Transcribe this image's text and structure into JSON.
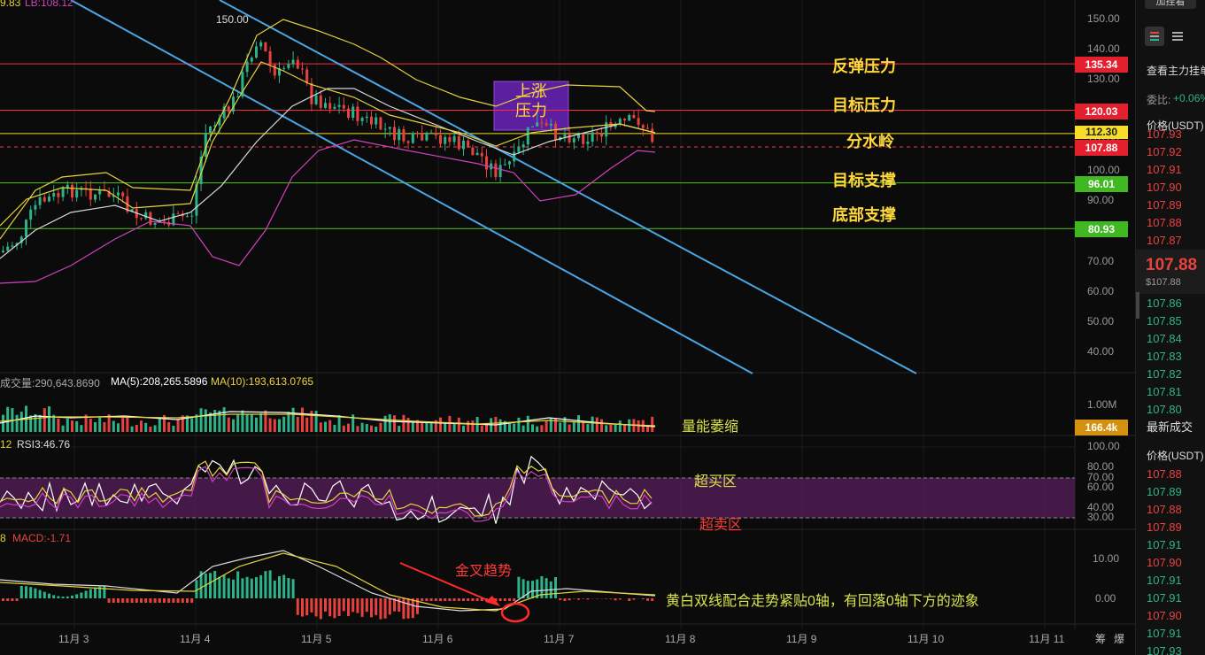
{
  "header": {
    "partial_left": "9.83",
    "partial_lb": "LB:108.12"
  },
  "price_axis": [
    "150.00",
    "140.00",
    "130.00",
    "120.00",
    "110.00",
    "100.00",
    "90.00",
    "80.00",
    "70.00",
    "60.00",
    "50.00",
    "40.00"
  ],
  "peak_label": "150.00",
  "levels": [
    {
      "name": "反弹压力",
      "price": "135.34",
      "color": "#ff2a3a"
    },
    {
      "name": "目标压力",
      "price": "120.03",
      "color": "#ff2a3a"
    },
    {
      "name": "分水岭",
      "price": "112.30",
      "color": "#f7dd2a"
    },
    {
      "name": "目标支撑",
      "price": "96.01",
      "color": "#52c41a"
    },
    {
      "name": "底部支撑",
      "price": "80.93",
      "color": "#52c41a"
    }
  ],
  "last_price_tag": "107.88",
  "box_label": "上涨\n压力",
  "volume": {
    "label": "成交量:290,643.8690",
    "ma5": "MA(5):208,265.5896",
    "ma10": "MA(10):193,613.0765",
    "axis": "1.00M",
    "tag": "166.4k",
    "annotation": "量能萎缩"
  },
  "rsi": {
    "label_prefix": "12",
    "label": "RSI3:46.76",
    "axis": [
      "100.00",
      "80.00",
      "70.00",
      "60.00",
      "40.00",
      "30.00"
    ],
    "overbought": "超买区",
    "oversold": "超卖区"
  },
  "macd": {
    "label_prefix": "8",
    "label": "MACD:-1.71",
    "axis": [
      "10.00",
      "0.00"
    ],
    "golden_cross": "金叉趋势",
    "comment": "黄白双线配合走势紧贴0轴，有回落0轴下方的迹象"
  },
  "dates": [
    "11月 3",
    "11月 4",
    "11月 5",
    "11月 6",
    "11月 7",
    "11月 8",
    "11月 9",
    "11月 10",
    "11月 11"
  ],
  "corner_icons": [
    "筹",
    "爆"
  ],
  "sidebar": {
    "top_button": "加挂看",
    "icons": [
      "orderbook-both-icon",
      "orderbook-list-icon"
    ],
    "title": "查看主力挂单",
    "ratio_label": "委比:",
    "ratio_value": "+0.06%",
    "price_header": "价格(USDT)",
    "asks": [
      "107.93",
      "107.92",
      "107.91",
      "107.90",
      "107.89",
      "107.88",
      "107.87"
    ],
    "last_price": "107.88",
    "last_price_usd": "$107.88",
    "bids": [
      "107.86",
      "107.85",
      "107.84",
      "107.83",
      "107.82",
      "107.81",
      "107.80"
    ],
    "trades_title": "最新成交",
    "trades_header": "价格(USDT)",
    "trades": [
      {
        "p": "107.88",
        "side": "sell"
      },
      {
        "p": "107.89",
        "side": "buy"
      },
      {
        "p": "107.88",
        "side": "sell"
      },
      {
        "p": "107.89",
        "side": "sell"
      },
      {
        "p": "107.91",
        "side": "buy"
      },
      {
        "p": "107.90",
        "side": "sell"
      },
      {
        "p": "107.91",
        "side": "buy"
      },
      {
        "p": "107.91",
        "side": "buy"
      },
      {
        "p": "107.90",
        "side": "sell"
      },
      {
        "p": "107.91",
        "side": "buy"
      },
      {
        "p": "107.93",
        "side": "buy"
      },
      {
        "p": "107.92",
        "side": "buy"
      }
    ]
  },
  "colors": {
    "up": "#2cb38a",
    "down": "#e8423f",
    "trendline": "#4aa6e6",
    "boll_upper": "#e6d23a",
    "boll_lower": "#d040c0",
    "ma_white": "#d8d8d8",
    "rsi_band": "#5a1f5c"
  }
}
